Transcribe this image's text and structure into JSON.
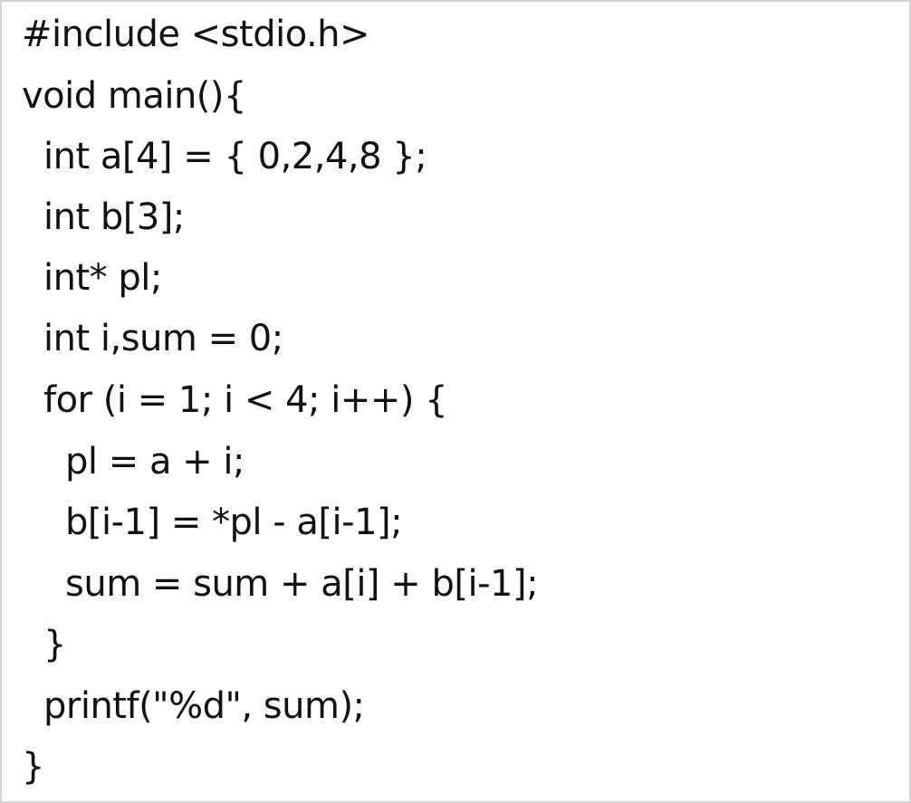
{
  "code": {
    "lines": [
      "#include <stdio.h>",
      "void main(){",
      "int a[4] = { 0,2,4,8 };",
      "int b[3];",
      "int* pl;",
      "int i,sum = 0;",
      "for (i = 1; i < 4; i++) {",
      "pl = a + i;",
      "b[i-1] = *pl - a[i-1];",
      "sum = sum + a[i] + b[i-1];",
      "}",
      "printf(\"%d\", sum);",
      "}"
    ]
  }
}
